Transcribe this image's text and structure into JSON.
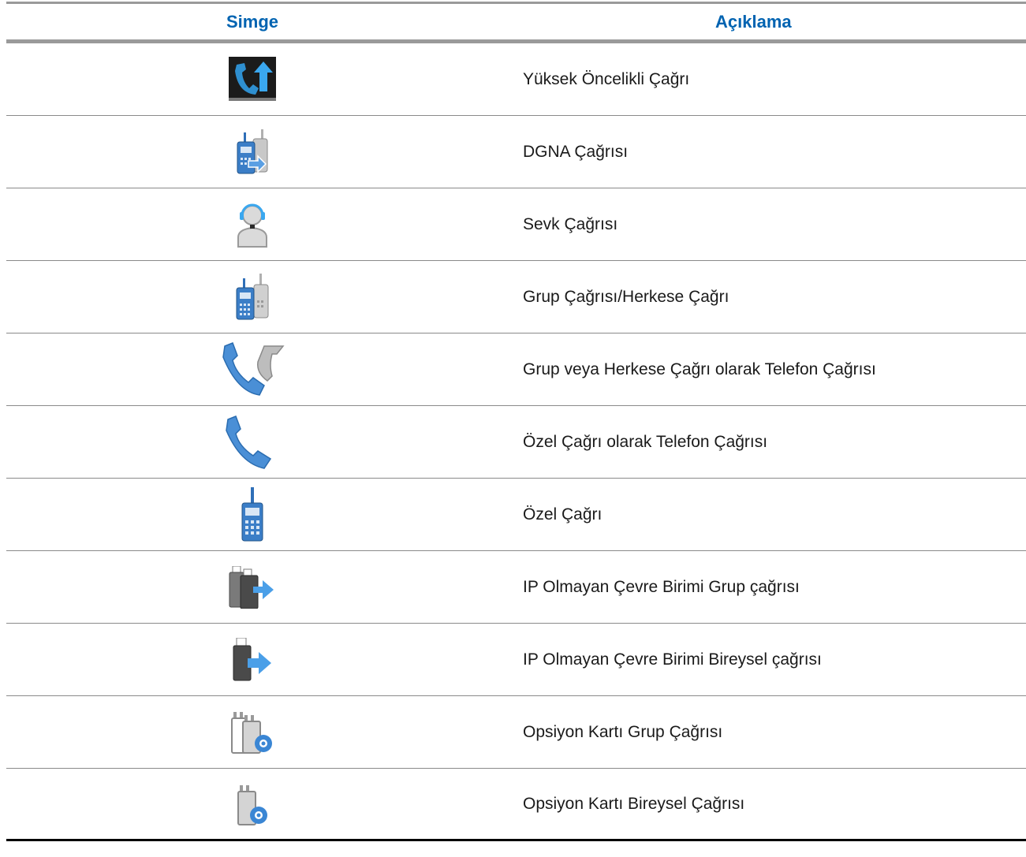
{
  "table": {
    "headers": {
      "symbol": "Simge",
      "description": "Açıklama"
    },
    "rows": [
      {
        "icon": "high-priority-call-icon",
        "description": "Yüksek Öncelikli Çağrı"
      },
      {
        "icon": "dgna-call-icon",
        "description": "DGNA Çağrısı"
      },
      {
        "icon": "dispatch-call-icon",
        "description": "Sevk Çağrısı"
      },
      {
        "icon": "group-call-icon",
        "description": "Grup Çağrısı/Herkese Çağrı"
      },
      {
        "icon": "phone-group-call-icon",
        "description": "Grup veya Herkese Çağrı olarak Telefon Çağrısı"
      },
      {
        "icon": "phone-private-call-icon",
        "description": "Özel Çağrı olarak Telefon Çağrısı"
      },
      {
        "icon": "private-call-icon",
        "description": "Özel Çağrı"
      },
      {
        "icon": "non-ip-peripheral-group-call-icon",
        "description": "IP Olmayan Çevre Birimi Grup çağrısı"
      },
      {
        "icon": "non-ip-peripheral-individual-call-icon",
        "description": "IP Olmayan Çevre Birimi Bireysel çağrısı"
      },
      {
        "icon": "option-card-group-call-icon",
        "description": "Opsiyon Kartı Grup Çağrısı"
      },
      {
        "icon": "option-card-individual-call-icon",
        "description": "Opsiyon Kartı Bireysel Çağrısı"
      }
    ]
  },
  "colors": {
    "header_text": "#0063b1",
    "icon_blue": "#4a8fd6",
    "icon_gray": "#9a9a9a"
  }
}
